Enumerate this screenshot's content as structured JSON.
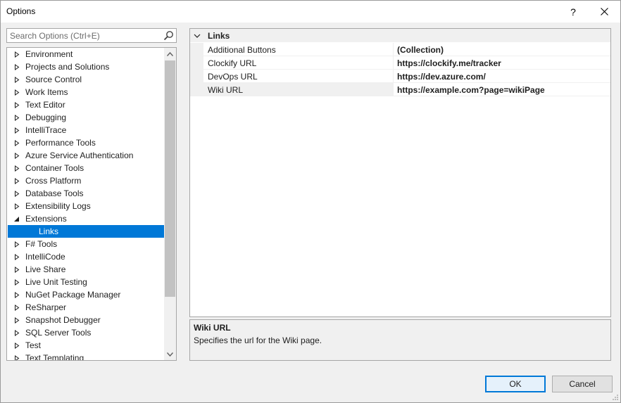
{
  "window": {
    "title": "Options",
    "help_label": "?"
  },
  "search": {
    "placeholder": "Search Options (Ctrl+E)"
  },
  "tree": {
    "items": [
      {
        "label": "Environment",
        "expanded": false
      },
      {
        "label": "Projects and Solutions",
        "expanded": false
      },
      {
        "label": "Source Control",
        "expanded": false
      },
      {
        "label": "Work Items",
        "expanded": false
      },
      {
        "label": "Text Editor",
        "expanded": false
      },
      {
        "label": "Debugging",
        "expanded": false
      },
      {
        "label": "IntelliTrace",
        "expanded": false
      },
      {
        "label": "Performance Tools",
        "expanded": false
      },
      {
        "label": "Azure Service Authentication",
        "expanded": false
      },
      {
        "label": "Container Tools",
        "expanded": false
      },
      {
        "label": "Cross Platform",
        "expanded": false
      },
      {
        "label": "Database Tools",
        "expanded": false
      },
      {
        "label": "Extensibility Logs",
        "expanded": false
      },
      {
        "label": "Extensions",
        "expanded": true
      },
      {
        "label": "Links",
        "child": true,
        "selected": true
      },
      {
        "label": "F# Tools",
        "expanded": false
      },
      {
        "label": "IntelliCode",
        "expanded": false
      },
      {
        "label": "Live Share",
        "expanded": false
      },
      {
        "label": "Live Unit Testing",
        "expanded": false
      },
      {
        "label": "NuGet Package Manager",
        "expanded": false
      },
      {
        "label": "ReSharper",
        "expanded": false
      },
      {
        "label": "Snapshot Debugger",
        "expanded": false
      },
      {
        "label": "SQL Server Tools",
        "expanded": false
      },
      {
        "label": "Test",
        "expanded": false
      },
      {
        "label": "Text Templating",
        "expanded": false
      }
    ]
  },
  "grid": {
    "category": "Links",
    "rows": [
      {
        "name": "Additional Buttons",
        "value": "(Collection)"
      },
      {
        "name": "Clockify URL",
        "value": "https://clockify.me/tracker"
      },
      {
        "name": "DevOps URL",
        "value": "https://dev.azure.com/"
      },
      {
        "name": "Wiki URL",
        "value": "https://example.com?page=wikiPage",
        "selected": true
      }
    ]
  },
  "description": {
    "title": "Wiki URL",
    "text": "Specifies the url for the Wiki page."
  },
  "buttons": {
    "ok": "OK",
    "cancel": "Cancel"
  },
  "colors": {
    "accent": "#0078d7",
    "selected_text": "#ffffff"
  }
}
